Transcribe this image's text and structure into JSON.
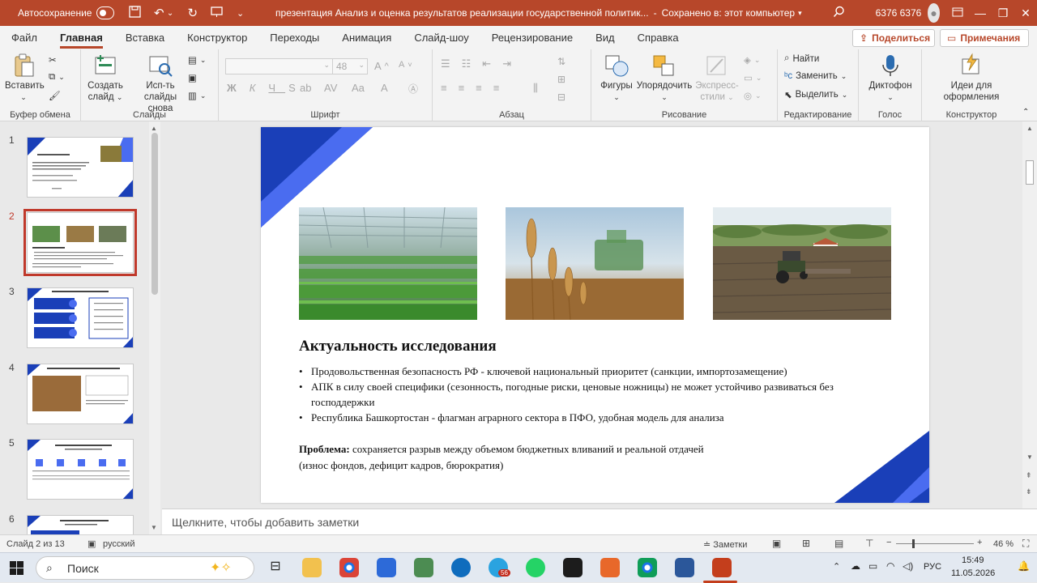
{
  "titlebar": {
    "autosave_label": "Автосохранение",
    "document_title": "презентация Анализ и оценка результатов реализации государственной политик...",
    "save_status": "Сохранено в: этот компьютер",
    "user_name": "6376 6376",
    "accent_color": "#b7472a"
  },
  "menu": {
    "tabs": [
      "Файл",
      "Главная",
      "Вставка",
      "Конструктор",
      "Переходы",
      "Анимация",
      "Слайд-шоу",
      "Рецензирование",
      "Вид",
      "Справка"
    ],
    "active_tab": "Главная",
    "share_label": "Поделиться",
    "comments_label": "Примечания"
  },
  "ribbon": {
    "clipboard": {
      "paste": "Вставить",
      "group": "Буфер обмена"
    },
    "slides": {
      "new_slide_line1": "Создать",
      "new_slide_line2": "слайд",
      "reuse_line1": "Исп-ть",
      "reuse_line2": "слайды снова",
      "group": "Слайды"
    },
    "font": {
      "font_size": "48",
      "group": "Шрифт"
    },
    "paragraph": {
      "group": "Абзац"
    },
    "drawing": {
      "shapes": "Фигуры",
      "arrange": "Упорядочить",
      "styles_line1": "Экспресс-",
      "styles_line2": "стили",
      "group": "Рисование"
    },
    "editing": {
      "find": "Найти",
      "replace": "Заменить",
      "select": "Выделить",
      "group": "Редактирование"
    },
    "voice": {
      "dictate": "Диктофон",
      "group": "Голос"
    },
    "designer": {
      "ideas_line1": "Идеи для",
      "ideas_line2": "оформления",
      "group": "Конструктор"
    }
  },
  "thumbnails": {
    "numbers": [
      "1",
      "2",
      "3",
      "4",
      "5",
      "6"
    ],
    "selected": "2"
  },
  "slide": {
    "title": "Актуальность исследования",
    "bullets": [
      "Продовольственная безопасность РФ - ключевой национальный приоритет (санкции, импортозамещение)",
      "АПК в силу своей специфики (сезонность, погодные риски, ценовые ножницы) не может устойчиво развиваться без господдержки",
      "Республика Башкортостан - флагман аграрного сектора в ПФО, удобная модель для анализа"
    ],
    "problem_label": "Проблема:",
    "problem_text": " сохраняется разрыв между объемом бюджетных вливаний и реальной отдачей",
    "problem_text2": "(износ фондов, дефицит кадров, бюрократия)",
    "accent_dark": "#1a3fb8",
    "accent_light": "#4a6cf0"
  },
  "notes": {
    "placeholder": "Щелкните, чтобы добавить заметки"
  },
  "status": {
    "slide_counter": "Слайд 2 из 13",
    "language": "русский",
    "notes_button": "Заметки",
    "zoom": "46 %"
  },
  "taskbar": {
    "search": "Поиск",
    "badge": "56",
    "lang": "РУС",
    "time": "15:49",
    "date": "11.05.2026"
  }
}
